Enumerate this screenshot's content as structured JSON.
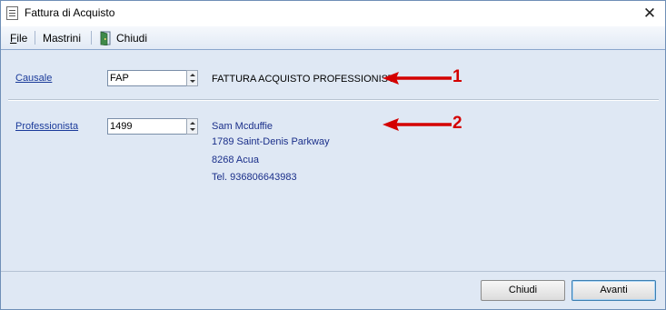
{
  "window": {
    "title": "Fattura di Acquisto"
  },
  "menu": {
    "file_prefix": "F",
    "file_rest": "ile",
    "mastrini": "Mastrini",
    "chiudi": "Chiudi"
  },
  "form": {
    "causale": {
      "label": "Causale",
      "value": "FAP",
      "description": "FATTURA ACQUISTO PROFESSIONISTI"
    },
    "professionista": {
      "label": "Professionista",
      "value": "1499",
      "name": "Sam Mcduffie",
      "address": "1789 Saint-Denis Parkway",
      "city": "8268 Acua",
      "phone": "Tel. 936806643983"
    }
  },
  "annotations": [
    {
      "number": "1"
    },
    {
      "number": "2"
    }
  ],
  "buttons": {
    "close": "Chiudi",
    "next": "Avanti"
  },
  "colors": {
    "arrow": "#d40000",
    "link": "#1a3a9a",
    "info_text": "#1a2f8a"
  }
}
